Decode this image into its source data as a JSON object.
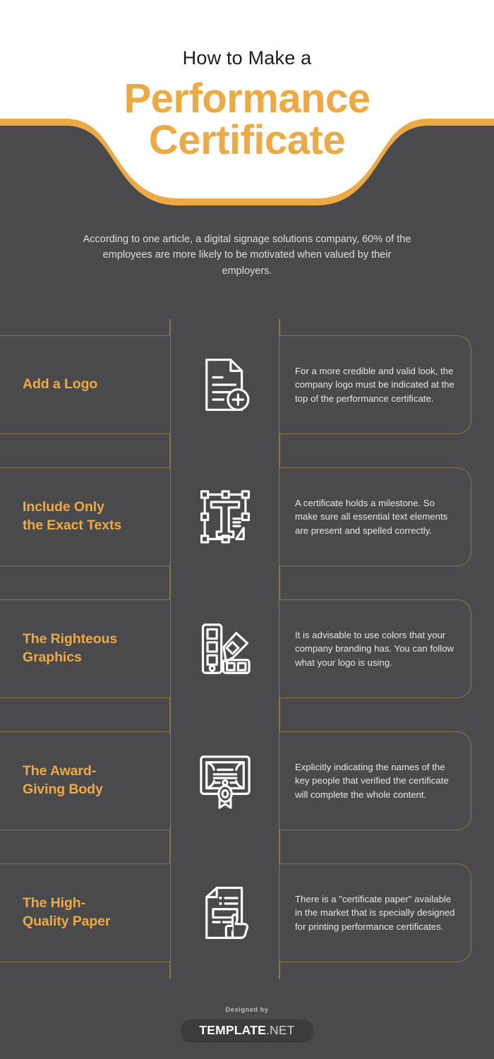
{
  "theme": {
    "background": "#4a4a4d",
    "accent": "#eda943",
    "border": "#8a7549",
    "body_text": "#e6e6e6",
    "header_background": "#ffffff"
  },
  "header": {
    "kicker": "How to Make a",
    "title_line1": "Performance",
    "title_line2": "Certificate"
  },
  "intro": {
    "text": "According to one article, a digital signage solutions company, 60% of the employees are more likely to be motivated when valued by their employers."
  },
  "steps": [
    {
      "label": "Add a Logo",
      "icon": "document-add-icon",
      "description": "For a more credible and valid look, the company logo must be indicated at the top of the performance certificate."
    },
    {
      "label_line1": "Include Only",
      "label_line2": "the Exact Texts",
      "label": "Include Only the Exact Texts",
      "icon": "text-tool-selection-icon",
      "description": "A certificate holds a milestone. So make sure all essential text elements are present and spelled correctly."
    },
    {
      "label_line1": "The Righteous",
      "label_line2": "Graphics",
      "label": "The Righteous Graphics",
      "icon": "color-palette-swatch-icon",
      "description": " It is advisable to use colors that your company branding has. You can follow what your logo is using."
    },
    {
      "label_line1": "The Award-",
      "label_line2": "Giving Body",
      "label": "The Award-Giving Body",
      "icon": "certificate-ribbon-icon",
      "description": "Explicitly indicating the names of the key people that verified the certificate will complete the whole content."
    },
    {
      "label_line1": "The High-",
      "label_line2": "Quality Paper",
      "label": "The High-Quality Paper",
      "icon": "document-thumbs-up-icon",
      "description": "There is a \"certificate paper\" available in the market that is specially designed for printing performance certificates."
    }
  ],
  "footer": {
    "designed_by": "Designed by",
    "brand_name": "TEMPLATE",
    "brand_tld": ".NET"
  }
}
